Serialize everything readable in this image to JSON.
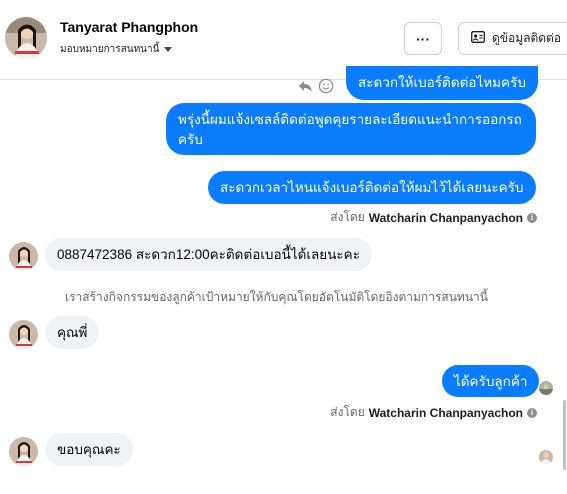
{
  "header": {
    "contact_name": "Tanyarat Phangphon",
    "assign_label": "มอบหมายการสนทนานี้",
    "more_label": "···",
    "view_contact_label": "ดูข้อมูลติดต่อ"
  },
  "messages": {
    "out_1": "สะดวกให้เบอร์ติดต่อไหมครับ",
    "out_2": "พรุ่งนี้ผมแจ้งเซลล์ติดต่อพูดคุยรายละเอียดแนะนำการออกรถครับ",
    "out_3": "สะดวกเวลาไหนแจ้งเบอร์ติดต่อให้ผมไว้ได้เลยนะครับ",
    "sent_by_prefix_1": "ส่งโดย",
    "sent_by_name_1": "Watcharin Chanpanyachon",
    "in_1": "0887472386 สะดวก12:00คะติดต่อเบอนี้ได้เลยนะคะ",
    "system_note": "เราสร้างกิจกรรมของลูกค้าเป้าหมายให้กับคุณโดยอัตโนมัติโดยอิงตามการสนทนานี้",
    "in_2": "คุณพี่",
    "out_4": "ได้ครับลูกค้า",
    "sent_by_prefix_2": "ส่งโดย",
    "sent_by_name_2": "Watcharin Chanpanyachon",
    "in_3": "ขอบคุณคะ"
  },
  "icons": {
    "info": "i"
  },
  "colors": {
    "outgoing_bubble": "#0a7cff",
    "incoming_bubble": "#f0f2f5"
  }
}
